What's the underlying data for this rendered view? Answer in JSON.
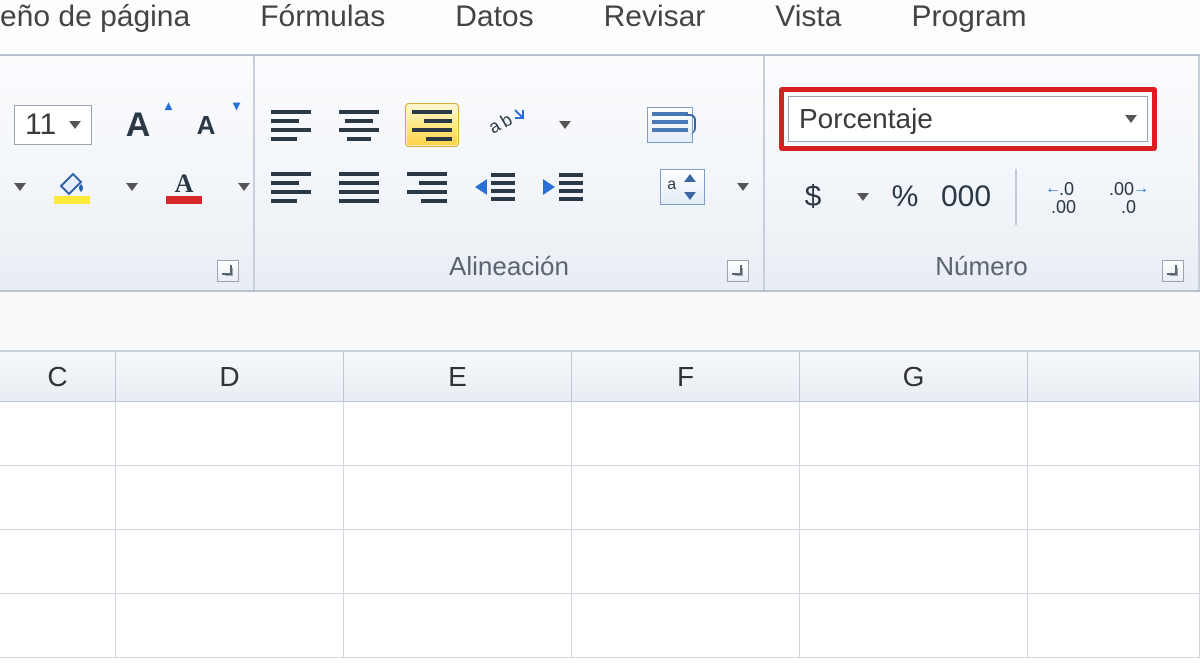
{
  "tabs": {
    "pageLayout": "eño de página",
    "formulas": "Fórmulas",
    "data": "Datos",
    "review": "Revisar",
    "view": "Vista",
    "developer": "Program"
  },
  "font": {
    "size": "11"
  },
  "groups": {
    "alignment": "Alineación",
    "number": "Número"
  },
  "number": {
    "formatSelected": "Porcentaje",
    "currency": "$",
    "percent": "%",
    "thousands": "000",
    "decInc": "←0\n  00",
    "decDec": "00\n→0"
  },
  "columns": [
    "C",
    "D",
    "E",
    "F",
    "G"
  ]
}
